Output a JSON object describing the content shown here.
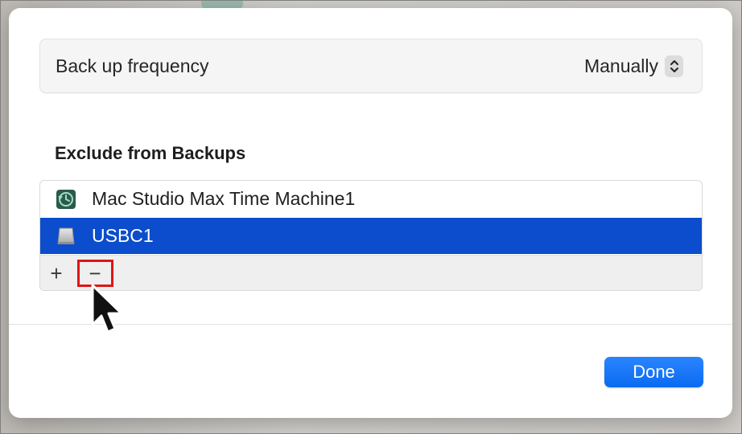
{
  "dialog": {
    "frequency": {
      "label": "Back up frequency",
      "value": "Manually"
    },
    "exclude_section": {
      "title": "Exclude from Backups",
      "items": [
        {
          "label": "Mac Studio Max Time Machine1",
          "icon": "time-machine-icon",
          "selected": false
        },
        {
          "label": "USBC1",
          "icon": "external-drive-icon",
          "selected": true
        }
      ],
      "toolbar": {
        "add_label": "+",
        "remove_label": "−"
      }
    },
    "done_label": "Done"
  },
  "colors": {
    "selection": "#0b4dcc",
    "accent": "#0a6bf0",
    "highlight": "#e01515"
  }
}
